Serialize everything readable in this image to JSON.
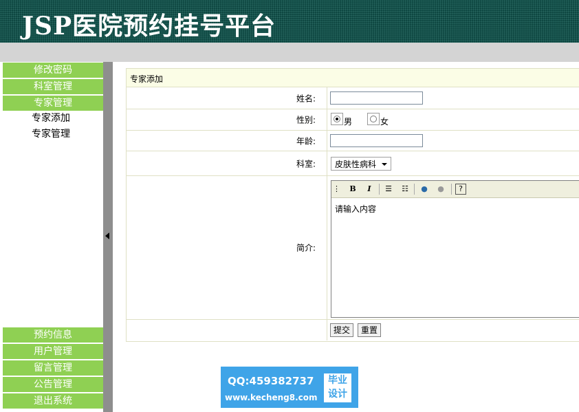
{
  "header": {
    "title": "JSP医院预约挂号平台"
  },
  "sidebar": {
    "top_items": [
      {
        "label": "修改密码"
      },
      {
        "label": "科室管理"
      },
      {
        "label": "专家管理"
      }
    ],
    "sub_items": [
      {
        "label": "专家添加"
      },
      {
        "label": "专家管理"
      }
    ],
    "bottom_items": [
      {
        "label": "预约信息"
      },
      {
        "label": "用户管理"
      },
      {
        "label": "留言管理"
      },
      {
        "label": "公告管理"
      },
      {
        "label": "退出系统"
      }
    ]
  },
  "form": {
    "heading": "专家添加",
    "name_label": "姓名:",
    "name_value": "",
    "gender_label": "性别:",
    "gender_male": "男",
    "gender_female": "女",
    "age_label": "年龄:",
    "age_value": "",
    "dept_label": "科室:",
    "dept_selected": "皮肤性病科",
    "intro_label": "简介:",
    "intro_text": "请输入内容",
    "toolbar": {
      "bold": "B",
      "italic": "I",
      "help": "?"
    },
    "submit_label": "提交",
    "reset_label": "重置"
  },
  "watermark": {
    "qq": "QQ:459382737",
    "url": "www.kecheng8.com",
    "badge_line1": "毕业",
    "badge_line2": "设计"
  }
}
